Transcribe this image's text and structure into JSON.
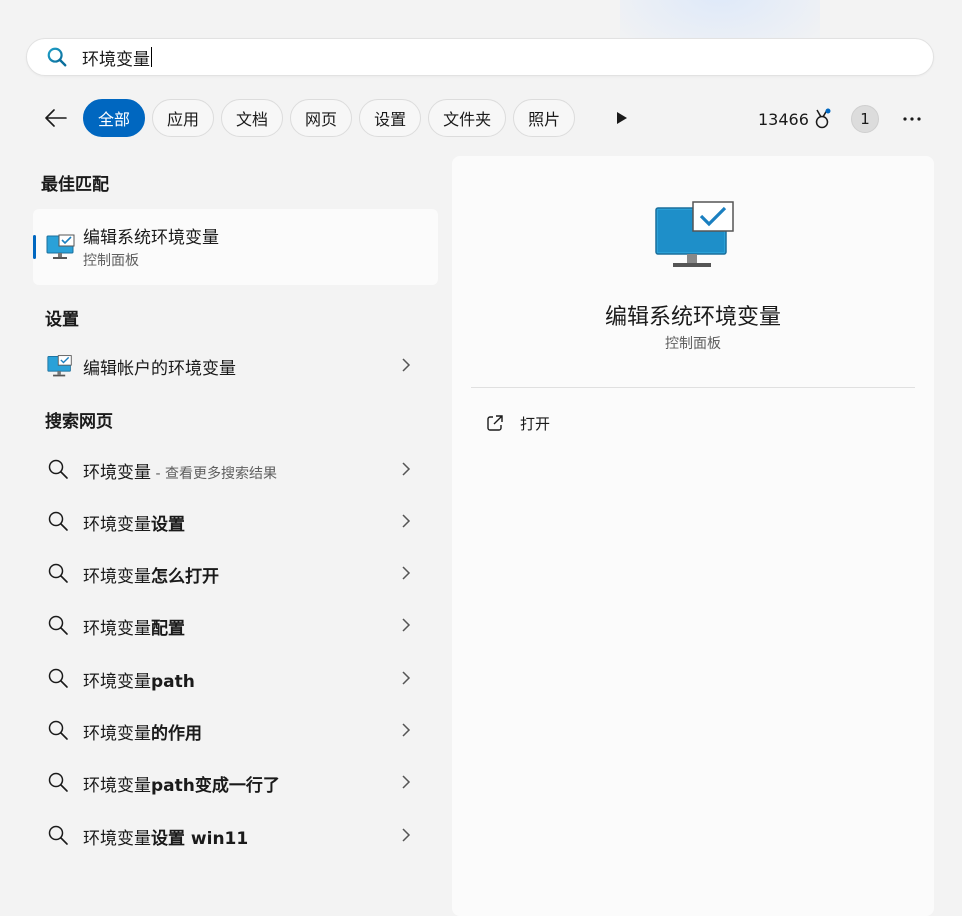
{
  "search": {
    "query": "环境变量"
  },
  "filters": {
    "chips": [
      {
        "label": "全部",
        "active": true
      },
      {
        "label": "应用",
        "active": false
      },
      {
        "label": "文档",
        "active": false
      },
      {
        "label": "网页",
        "active": false
      },
      {
        "label": "设置",
        "active": false
      },
      {
        "label": "文件夹",
        "active": false
      },
      {
        "label": "照片",
        "active": false
      }
    ],
    "points": "13466",
    "badge": "1"
  },
  "best_match": {
    "section": "最佳匹配",
    "title": "编辑系统环境变量",
    "subtitle": "控制面板"
  },
  "settings": {
    "section": "设置",
    "items": [
      {
        "label": "编辑帐户的环境变量"
      }
    ]
  },
  "web": {
    "section": "搜索网页",
    "items": [
      {
        "query": "环境变量",
        "bold": "",
        "suffix": " - 查看更多搜索结果"
      },
      {
        "query": "环境变量",
        "bold": "设置",
        "suffix": ""
      },
      {
        "query": "环境变量",
        "bold": "怎么打开",
        "suffix": ""
      },
      {
        "query": "环境变量",
        "bold": "配置",
        "suffix": ""
      },
      {
        "query": "环境变量",
        "bold": "path",
        "suffix": ""
      },
      {
        "query": "环境变量",
        "bold": "的作用",
        "suffix": ""
      },
      {
        "query": "环境变量",
        "bold": "path变成一行了",
        "suffix": ""
      },
      {
        "query": "环境变量",
        "bold": "设置 win11",
        "suffix": ""
      }
    ]
  },
  "preview": {
    "title": "编辑系统环境变量",
    "subtitle": "控制面板",
    "action_open": "打开"
  },
  "colors": {
    "accent": "#0067c0",
    "background": "#f3f3f3",
    "panel": "#fbfbfb"
  },
  "icons": [
    "search-icon",
    "back-arrow-icon",
    "play-icon",
    "rewards-icon",
    "more-icon",
    "monitor-check-icon",
    "chevron-right-icon",
    "open-external-icon"
  ]
}
